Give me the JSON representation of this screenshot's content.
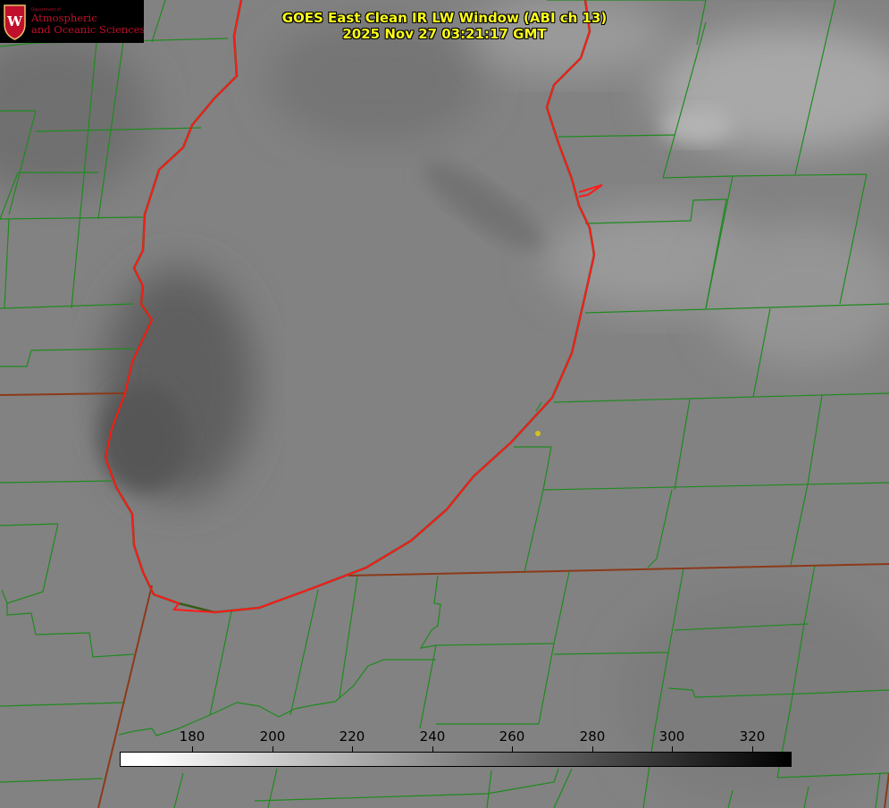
{
  "header": {
    "title_line1": "GOES East Clean IR LW Window (ABI ch 13)",
    "title_line2": "2025 Nov 27 03:21:17 GMT"
  },
  "logo": {
    "department": "Department of",
    "line1": "Atmospheric",
    "line2": "and Oceanic Sciences",
    "seal_letter": "W"
  },
  "colorbar": {
    "ticks": [
      "180",
      "200",
      "220",
      "240",
      "260",
      "280",
      "300",
      "320"
    ],
    "min_label_value": 180,
    "max_label_value": 320,
    "gradient": "white-to-black"
  },
  "colors": {
    "title": "#ffff1a",
    "county_lines": "#228b22",
    "state_lines": "#8b3a1a",
    "lake_outline": "#ff1a1a",
    "marker": "#d4c21a",
    "logo_red": "#c0102b"
  },
  "map": {
    "lake_name": "Lake Michigan",
    "features": [
      "county-boundaries",
      "state-boundaries",
      "lake-shoreline",
      "station-marker"
    ]
  }
}
